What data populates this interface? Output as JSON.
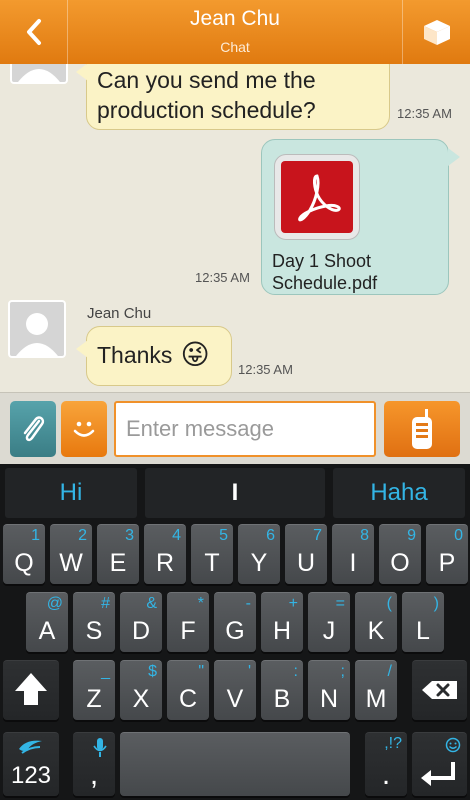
{
  "header": {
    "title": "Jean Chu",
    "subtitle": "Chat"
  },
  "chat": {
    "messages": [
      {
        "text": "Can you send me the production schedule?",
        "time": "12:35 AM"
      },
      {
        "file_name": "Day 1 Shoot Schedule.pdf",
        "file_line1": "Day 1 Shoot",
        "file_line2": "Schedule.pdf",
        "time": "12:35 AM"
      },
      {
        "sender": "Jean Chu",
        "text": "Thanks",
        "emoji": "😜",
        "time": "12:35 AM"
      }
    ]
  },
  "input": {
    "placeholder": "Enter message"
  },
  "keyboard": {
    "suggestions": [
      "Hi",
      "I",
      "Haha"
    ],
    "row1": [
      {
        "main": "Q",
        "alt": "1"
      },
      {
        "main": "W",
        "alt": "2"
      },
      {
        "main": "E",
        "alt": "3"
      },
      {
        "main": "R",
        "alt": "4"
      },
      {
        "main": "T",
        "alt": "5"
      },
      {
        "main": "Y",
        "alt": "6"
      },
      {
        "main": "U",
        "alt": "7"
      },
      {
        "main": "I",
        "alt": "8"
      },
      {
        "main": "O",
        "alt": "9"
      },
      {
        "main": "P",
        "alt": "0"
      }
    ],
    "row2": [
      {
        "main": "A",
        "alt": "@"
      },
      {
        "main": "S",
        "alt": "#"
      },
      {
        "main": "D",
        "alt": "&"
      },
      {
        "main": "F",
        "alt": "*"
      },
      {
        "main": "G",
        "alt": "-"
      },
      {
        "main": "H",
        "alt": "+"
      },
      {
        "main": "J",
        "alt": "="
      },
      {
        "main": "K",
        "alt": "("
      },
      {
        "main": "L",
        "alt": ")"
      }
    ],
    "row3": [
      {
        "main": "Z",
        "alt": "_"
      },
      {
        "main": "X",
        "alt": "$"
      },
      {
        "main": "C",
        "alt": "\""
      },
      {
        "main": "V",
        "alt": "'"
      },
      {
        "main": "B",
        "alt": ":"
      },
      {
        "main": "N",
        "alt": ";"
      },
      {
        "main": "M",
        "alt": "/"
      }
    ],
    "symbols_key": "123",
    "comma_key": ",",
    "period_key": ".",
    "period_alt": ",!?"
  },
  "colors": {
    "header": "#e9861c",
    "accent_blue": "#33b5e5",
    "incoming_bubble": "#fbf3c6",
    "outgoing_bubble": "#c9e6df"
  },
  "icons": [
    "back-arrow-icon",
    "box-icon",
    "person-avatar-icon",
    "pdf-icon",
    "paperclip-icon",
    "smiley-icon",
    "walkie-talkie-icon",
    "shift-icon",
    "backspace-icon",
    "swiftkey-icon",
    "microphone-icon",
    "enter-icon"
  ]
}
